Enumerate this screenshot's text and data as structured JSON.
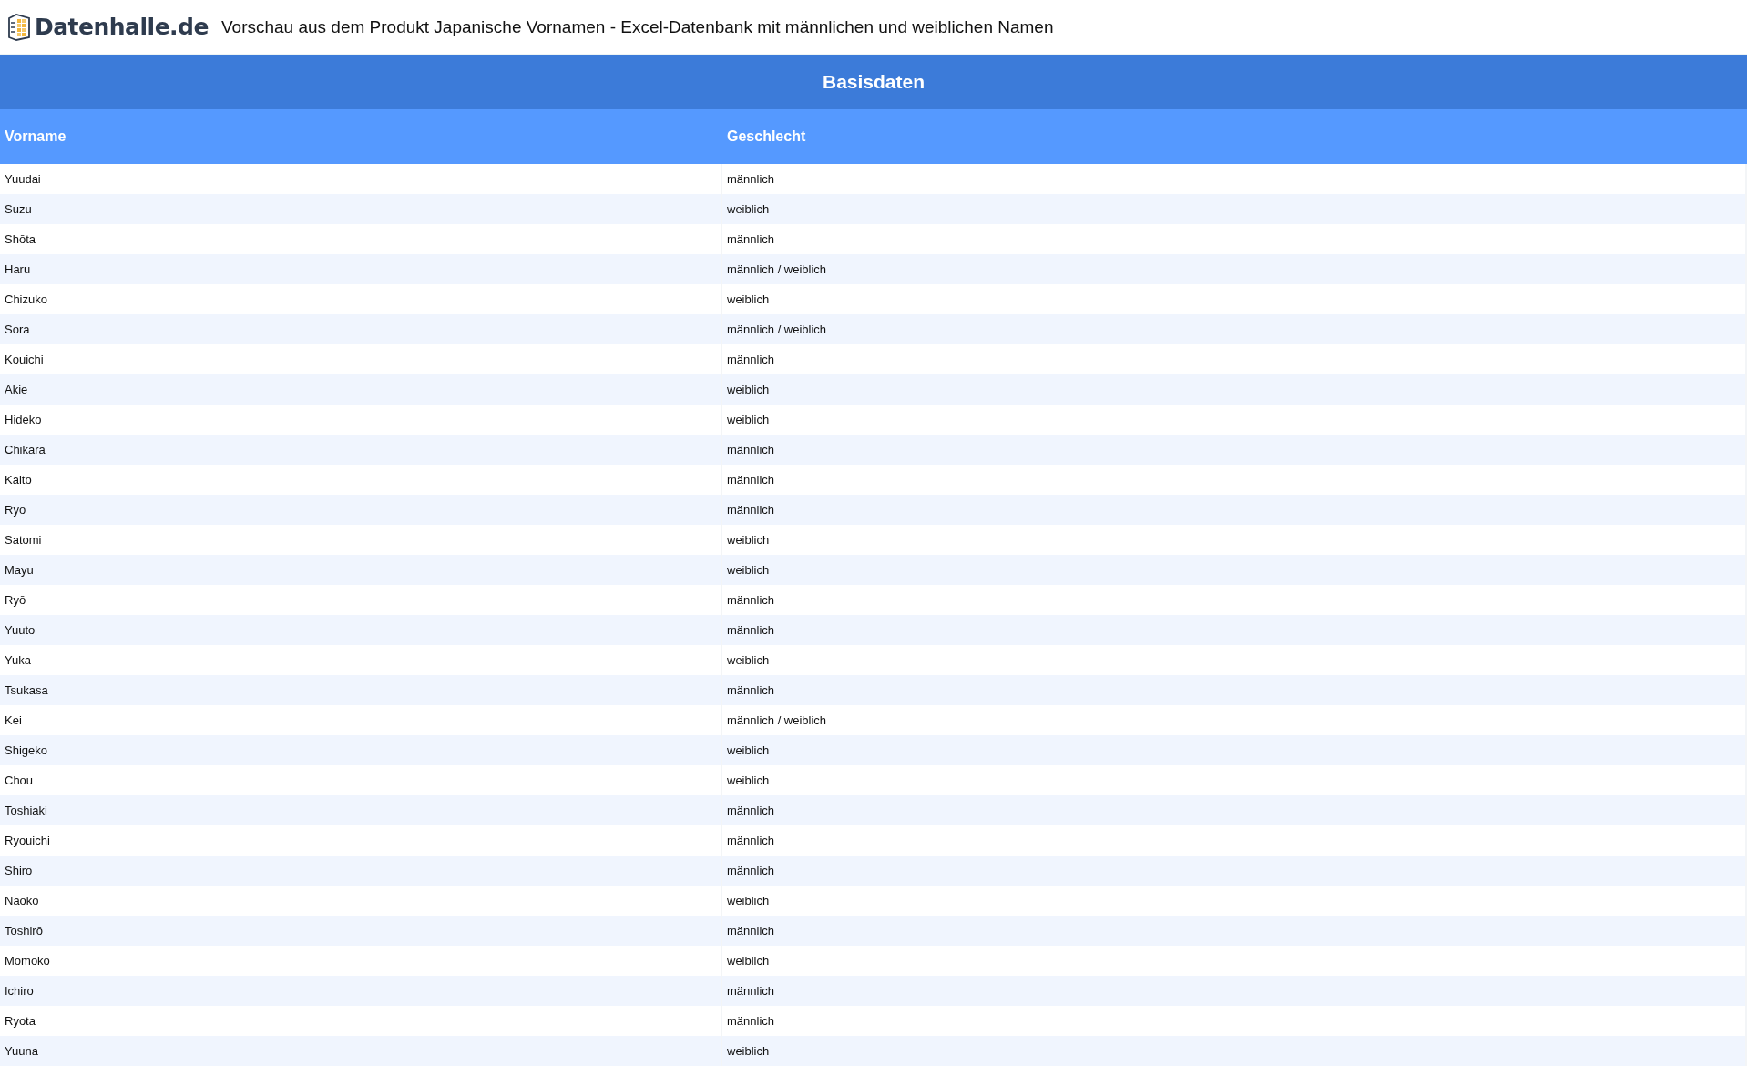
{
  "header": {
    "logo_text": "Datenhalle.de",
    "title": "Vorschau aus dem Produkt Japanische Vornamen - Excel-Datenbank mit männlichen und weiblichen Namen"
  },
  "table": {
    "caption": "Basisdaten",
    "columns": [
      "Vorname",
      "Geschlecht"
    ],
    "rows": [
      [
        "Yuudai",
        "männlich"
      ],
      [
        "Suzu",
        "weiblich"
      ],
      [
        "Shōta",
        "männlich"
      ],
      [
        "Haru",
        "männlich / weiblich"
      ],
      [
        "Chizuko",
        "weiblich"
      ],
      [
        "Sora",
        "männlich / weiblich"
      ],
      [
        "Kouichi",
        "männlich"
      ],
      [
        "Akie",
        "weiblich"
      ],
      [
        "Hideko",
        "weiblich"
      ],
      [
        "Chikara",
        "männlich"
      ],
      [
        "Kaito",
        "männlich"
      ],
      [
        "Ryo",
        "männlich"
      ],
      [
        "Satomi",
        "weiblich"
      ],
      [
        "Mayu",
        "weiblich"
      ],
      [
        "Ryō",
        "männlich"
      ],
      [
        "Yuuto",
        "männlich"
      ],
      [
        "Yuka",
        "weiblich"
      ],
      [
        "Tsukasa",
        "männlich"
      ],
      [
        "Kei",
        "männlich / weiblich"
      ],
      [
        "Shigeko",
        "weiblich"
      ],
      [
        "Chou",
        "weiblich"
      ],
      [
        "Toshiaki",
        "männlich"
      ],
      [
        "Ryouichi",
        "männlich"
      ],
      [
        "Shiro",
        "männlich"
      ],
      [
        "Naoko",
        "weiblich"
      ],
      [
        "Toshirō",
        "männlich"
      ],
      [
        "Momoko",
        "weiblich"
      ],
      [
        "Ichiro",
        "männlich"
      ],
      [
        "Ryota",
        "männlich"
      ],
      [
        "Yuuna",
        "weiblich"
      ]
    ]
  }
}
